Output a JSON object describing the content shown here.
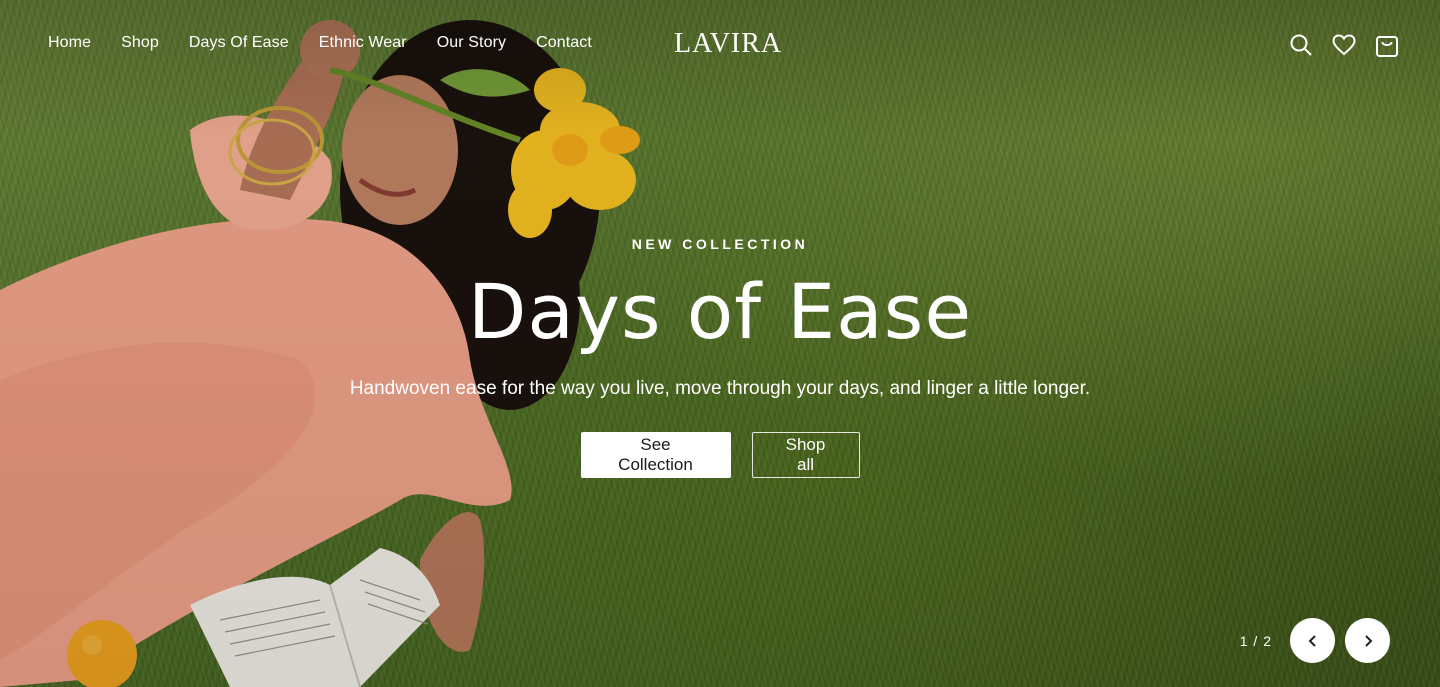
{
  "nav": {
    "items": [
      {
        "label": "Home"
      },
      {
        "label": "Shop"
      },
      {
        "label": "Days Of Ease"
      },
      {
        "label": "Ethnic Wear"
      },
      {
        "label": "Our Story"
      },
      {
        "label": "Contact"
      }
    ]
  },
  "brand": {
    "logo_text": "LAVIRA"
  },
  "header_icons": [
    "search-icon",
    "heart-icon",
    "bag-icon"
  ],
  "hero": {
    "eyebrow": "NEW COLLECTION",
    "title": "Days of Ease",
    "subtitle": "Handwoven ease for the way you live, move through your days, and linger a little longer.",
    "primary_cta": "See Collection",
    "secondary_cta": "Shop all"
  },
  "slider": {
    "counter": "1 / 2"
  },
  "colors": {
    "text": "#ffffff",
    "button_bg": "#ffffff",
    "button_text": "#1a1a1a",
    "grass": "#4a6b22",
    "dress": "#f2a98f"
  }
}
